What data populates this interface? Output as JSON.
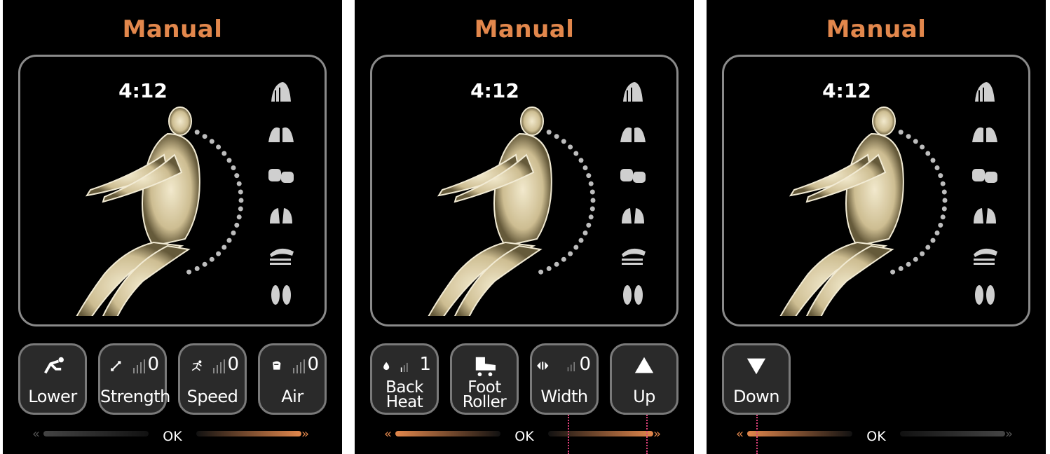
{
  "colors": {
    "accent": "#e2874c",
    "frame": "#8a8a8a",
    "button_bg": "#2a2a2a"
  },
  "panels": [
    {
      "title": "Manual",
      "timer": "4:12",
      "side_icons": [
        "hand-knead-icon",
        "hand-clap-icon",
        "hand-fist-icon",
        "hand-tap-icon",
        "hand-press-icon",
        "foot-icon"
      ],
      "buttons": [
        {
          "label": "Lower",
          "icon": "recline-icon"
        },
        {
          "label": "Strength",
          "icon": "strength-icon",
          "level": "0"
        },
        {
          "label": "Speed",
          "icon": "speed-icon",
          "level": "0"
        },
        {
          "label": "Air",
          "icon": "air-icon",
          "level": "0"
        }
      ],
      "ok_label": "OK"
    },
    {
      "title": "Manual",
      "timer": "4:12",
      "side_icons": [
        "hand-knead-icon",
        "hand-clap-icon",
        "hand-fist-icon",
        "hand-tap-icon",
        "hand-press-icon",
        "foot-icon"
      ],
      "buttons": [
        {
          "label1": "Back",
          "label2": "Heat",
          "icon": "flame-icon",
          "level": "1"
        },
        {
          "label1": "Foot",
          "label2": "Roller",
          "icon": "roller-icon"
        },
        {
          "label": "Width",
          "icon": "width-icon",
          "level": "0"
        },
        {
          "label": "Up",
          "icon": "up-triangle-icon"
        }
      ],
      "ok_label": "OK"
    },
    {
      "title": "Manual",
      "timer": "4:12",
      "side_icons": [
        "hand-knead-icon",
        "hand-clap-icon",
        "hand-fist-icon",
        "hand-tap-icon",
        "hand-press-icon",
        "foot-icon"
      ],
      "buttons": [
        {
          "label": "Down",
          "icon": "down-triangle-icon"
        }
      ],
      "ok_label": "OK"
    }
  ]
}
